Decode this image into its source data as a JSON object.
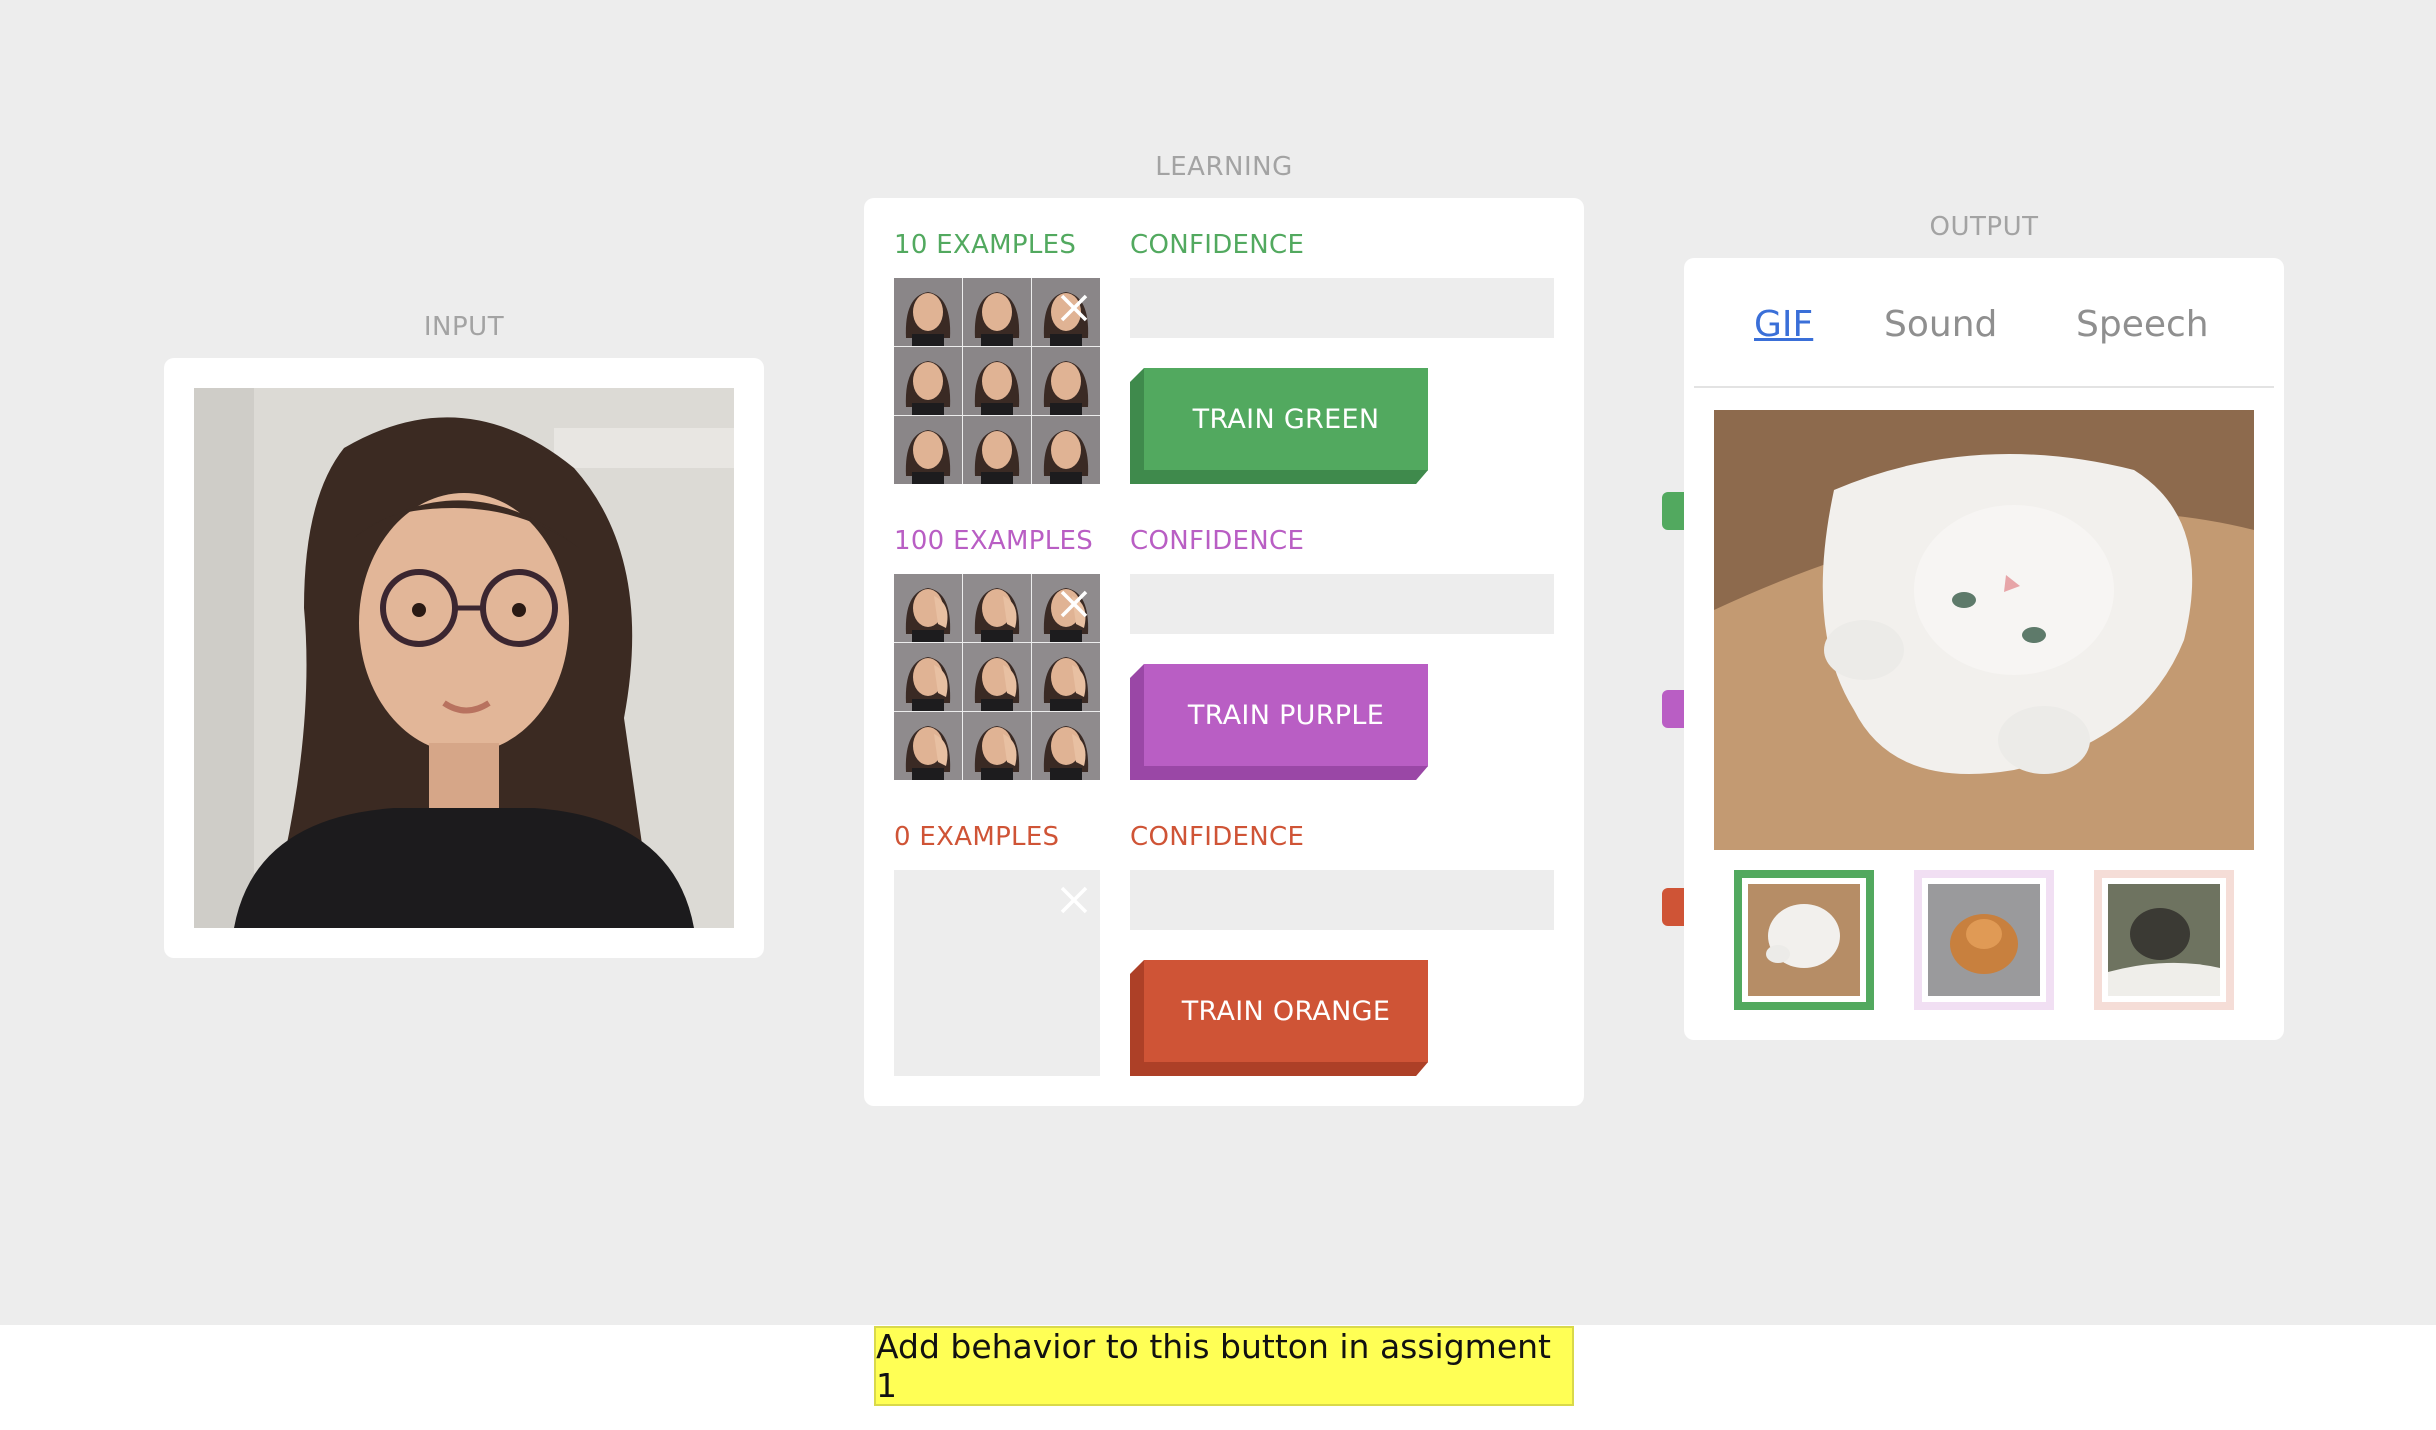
{
  "sections": {
    "input_title": "INPUT",
    "learning_title": "LEARNING",
    "output_title": "OUTPUT"
  },
  "classes": [
    {
      "examples_label": "10 EXAMPLES",
      "confidence_label": "CONFIDENCE",
      "button_label": "TRAIN GREEN",
      "color": "#52a95f",
      "shade": "#3f8a4c",
      "confidence": 0
    },
    {
      "examples_label": "100 EXAMPLES",
      "confidence_label": "CONFIDENCE",
      "button_label": "TRAIN PURPLE",
      "color": "#b95ec4",
      "shade": "#9a47a6",
      "confidence": 0
    },
    {
      "examples_label": "0 EXAMPLES",
      "confidence_label": "CONFIDENCE",
      "button_label": "TRAIN ORANGE",
      "color": "#cf5436",
      "shade": "#ad4027",
      "confidence": 0
    }
  ],
  "output": {
    "tabs": [
      {
        "label": "GIF",
        "active": true
      },
      {
        "label": "Sound",
        "active": false
      },
      {
        "label": "Speech",
        "active": false
      }
    ],
    "selected_choice": 0
  },
  "icons": {
    "clear": "close-icon"
  },
  "bottom_button": "Add behavior to this button in assigment 1"
}
